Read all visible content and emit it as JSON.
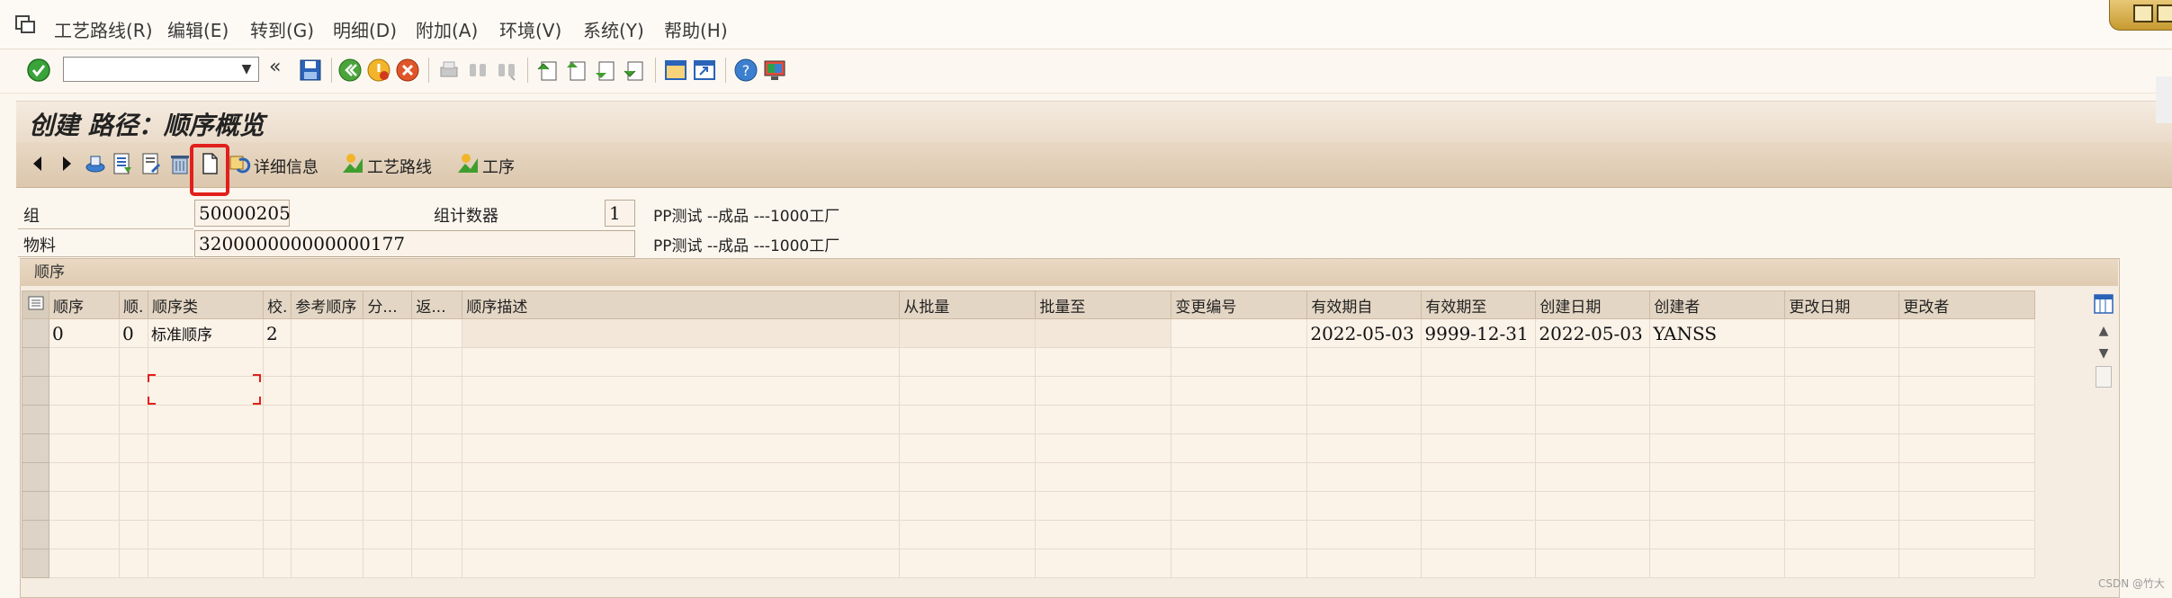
{
  "menu": {
    "items": [
      "工艺路线(R)",
      "编辑(E)",
      "转到(G)",
      "明细(D)",
      "附加(A)",
      "环境(V)",
      "系统(Y)",
      "帮助(H)"
    ]
  },
  "toolbar": {
    "command_value": "",
    "back_glyph": "«"
  },
  "title": "创建 路径：顺序概览",
  "app_toolbar": {
    "details_label": "详细信息",
    "routing_label": "工艺路线",
    "operation_label": "工序"
  },
  "header": {
    "group_label": "组",
    "group_value": "50000205",
    "counter_label": "组计数器",
    "counter_value": "1",
    "group_desc": "PP测试 --成品 ---1000工厂",
    "material_label": "物料",
    "material_value": "320000000000000177",
    "material_desc": "PP测试 --成品 ---1000工厂"
  },
  "table": {
    "caption": "顺序",
    "columns": [
      "顺序",
      "顺.",
      "顺序类",
      "校.",
      "参考顺序",
      "分...",
      "返...",
      "顺序描述",
      "从批量",
      "批量至",
      "变更编号",
      "有效期自",
      "有效期至",
      "创建日期",
      "创建者",
      "更改日期",
      "更改者"
    ],
    "rows": [
      [
        "0",
        "0",
        "标准顺序",
        "2",
        "",
        "",
        "",
        "",
        "",
        "",
        "",
        "2022-05-03",
        "9999-12-31",
        "2022-05-03",
        "YANSS",
        "",
        ""
      ]
    ]
  },
  "scroll": {
    "up_glyph": "▲",
    "down_glyph": "▼"
  },
  "watermark": "CSDN @竹大"
}
